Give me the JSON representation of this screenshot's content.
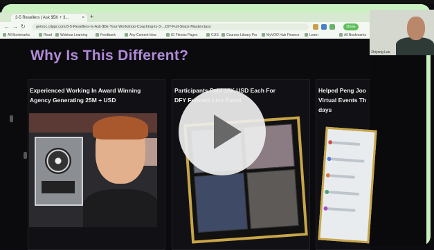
{
  "browser": {
    "tab_title": "3-5 Resellers | Ask $5K + 3...",
    "tab_close": "×",
    "new_tab": "+",
    "url": "getvoc.clippr.com/3-5-Resellers-Is-Ask-$5k-Your-Workshop-Coaching-Is-3-...DIY-Full-Stack-Masterclass",
    "done_label": "Done",
    "bookmarks": [
      "All Bookmarks",
      "Read",
      "Webinar Learning",
      "Feedback",
      "Any Content Idea",
      "IG Fitness Pages",
      "CJIS",
      "Courses Library Pro",
      "MyVOO Hub Finance",
      "Learn",
      "All Bookmarks"
    ]
  },
  "page": {
    "heading": "Why Is This Different?",
    "cards": [
      {
        "title_line1": "Experienced Working In Award Winning",
        "title_line2": "Agency Generating 25M + USD"
      },
      {
        "title_line1": "Participants Paid 15K USD Each For",
        "title_line2": "DFY Funnels Live Event"
      },
      {
        "title_line1": "Helped Peng Joo",
        "title_line2": "Virtual Events Th",
        "title_line3": "days"
      }
    ]
  },
  "video": {
    "control": "play"
  },
  "webcam": {
    "name": "Zhiyong Lee"
  },
  "icons": [
    "back-arrow-icon",
    "forward-arrow-icon",
    "reload-icon",
    "play-icon",
    "star-icon",
    "extension-icon"
  ]
}
